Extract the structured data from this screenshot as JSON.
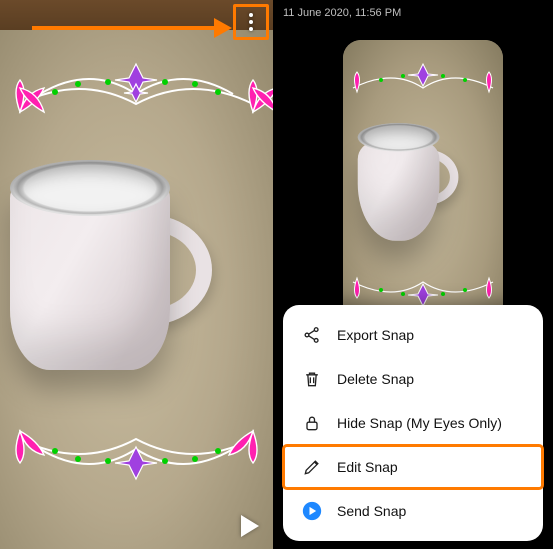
{
  "annotation": {
    "target": "more-options-button",
    "highlightMenuItem": "edit"
  },
  "left": {
    "moreIcon": "more-vertical-icon",
    "sendIcon": "send-triangle-icon"
  },
  "right": {
    "timestamp": "11 June 2020, 11:56 PM",
    "sheet": {
      "items": [
        {
          "id": "export",
          "label": "Export Snap",
          "icon": "share-icon"
        },
        {
          "id": "delete",
          "label": "Delete Snap",
          "icon": "trash-icon"
        },
        {
          "id": "hide",
          "label": "Hide Snap (My Eyes Only)",
          "icon": "lock-icon"
        },
        {
          "id": "edit",
          "label": "Edit Snap",
          "icon": "pencil-icon"
        },
        {
          "id": "send",
          "label": "Send Snap",
          "icon": "send-circle-icon"
        }
      ]
    }
  },
  "colors": {
    "annotation": "#ff7a00",
    "sendBlue": "#1e88ff"
  }
}
